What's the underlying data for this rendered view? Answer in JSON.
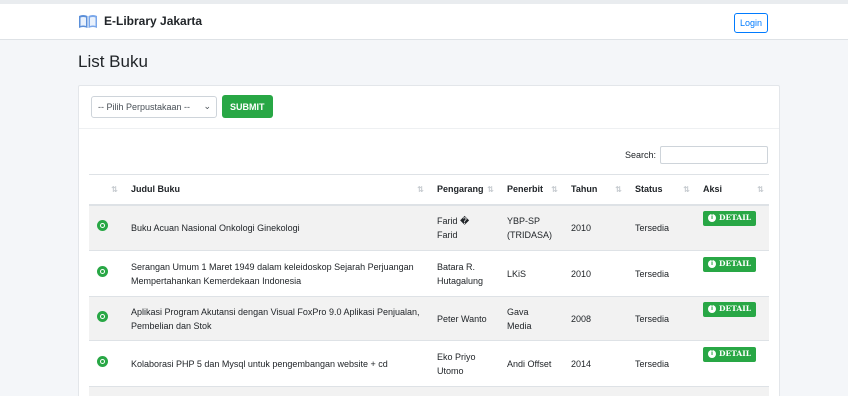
{
  "navbar": {
    "brand": "E-Library Jakarta",
    "login_label": "Login"
  },
  "page": {
    "title": "List Buku"
  },
  "filter": {
    "select_value": "-- Pilih Perpustakaan --",
    "submit_label": "SUBMIT"
  },
  "search": {
    "label": "Search:"
  },
  "table": {
    "headers": [
      "Judul Buku",
      "Pengarang",
      "Penerbit",
      "Tahun",
      "Status",
      "Aksi"
    ],
    "detail_label": "DETAIL",
    "rows": [
      {
        "judul": "Buku Acuan Nasional Onkologi Ginekologi",
        "pengarang": "Farid � Farid",
        "penerbit": "YBP-SP (TRIDASA)",
        "tahun": "2010",
        "status": "Tersedia"
      },
      {
        "judul": "Serangan Umum 1 Maret 1949 dalam keleidoskop Sejarah Perjuangan Mempertahankan Kemerdekaan Indonesia",
        "pengarang": "Batara R. Hutagalung",
        "penerbit": "LKiS",
        "tahun": "2010",
        "status": "Tersedia"
      },
      {
        "judul": "Aplikasi Program Akutansi dengan Visual FoxPro 9.0 Aplikasi Penjualan, Pembelian dan Stok",
        "pengarang": "Peter Wanto",
        "penerbit": "Gava Media",
        "tahun": "2008",
        "status": "Tersedia"
      },
      {
        "judul": "Kolaborasi PHP 5 dan Mysql untuk pengembangan website + cd",
        "pengarang": "Eko Priyo Utomo",
        "penerbit": "Andi Offset",
        "tahun": "2014",
        "status": "Tersedia"
      }
    ]
  },
  "colors": {
    "accent_green": "#28a745",
    "link_blue": "#007bff"
  }
}
